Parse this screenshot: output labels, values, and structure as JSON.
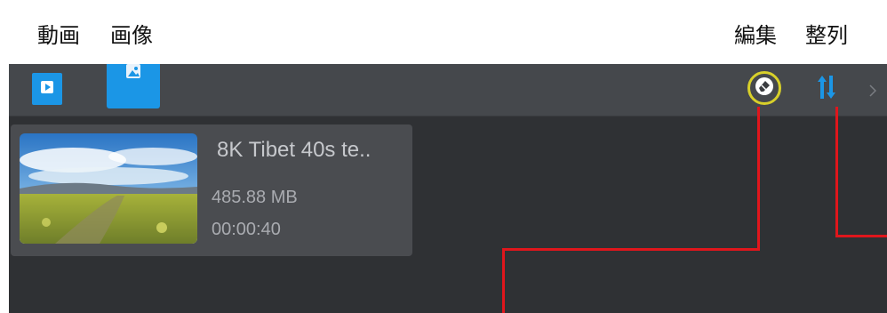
{
  "annotations": {
    "video_label": "動画",
    "image_label": "画像",
    "edit_label": "編集",
    "sort_label": "整列"
  },
  "toolbar": {
    "video_tab_icon": "play-icon",
    "image_tab_icon": "image-icon",
    "edit_icon": "eraser-icon",
    "sort_icon": "sort-arrows-icon",
    "accent_color": "#1b96e6",
    "highlight_color": "#d8d02a"
  },
  "media_list": {
    "items": [
      {
        "title": "8K Tibet 40s te..",
        "size": "485.88 MB",
        "duration": "00:00:40",
        "thumbnail": "panorama-thumbnail"
      }
    ]
  },
  "colors": {
    "leader_line": "#e0161c",
    "toolbar_bg": "#45484c",
    "panel_bg": "#2f3134"
  }
}
